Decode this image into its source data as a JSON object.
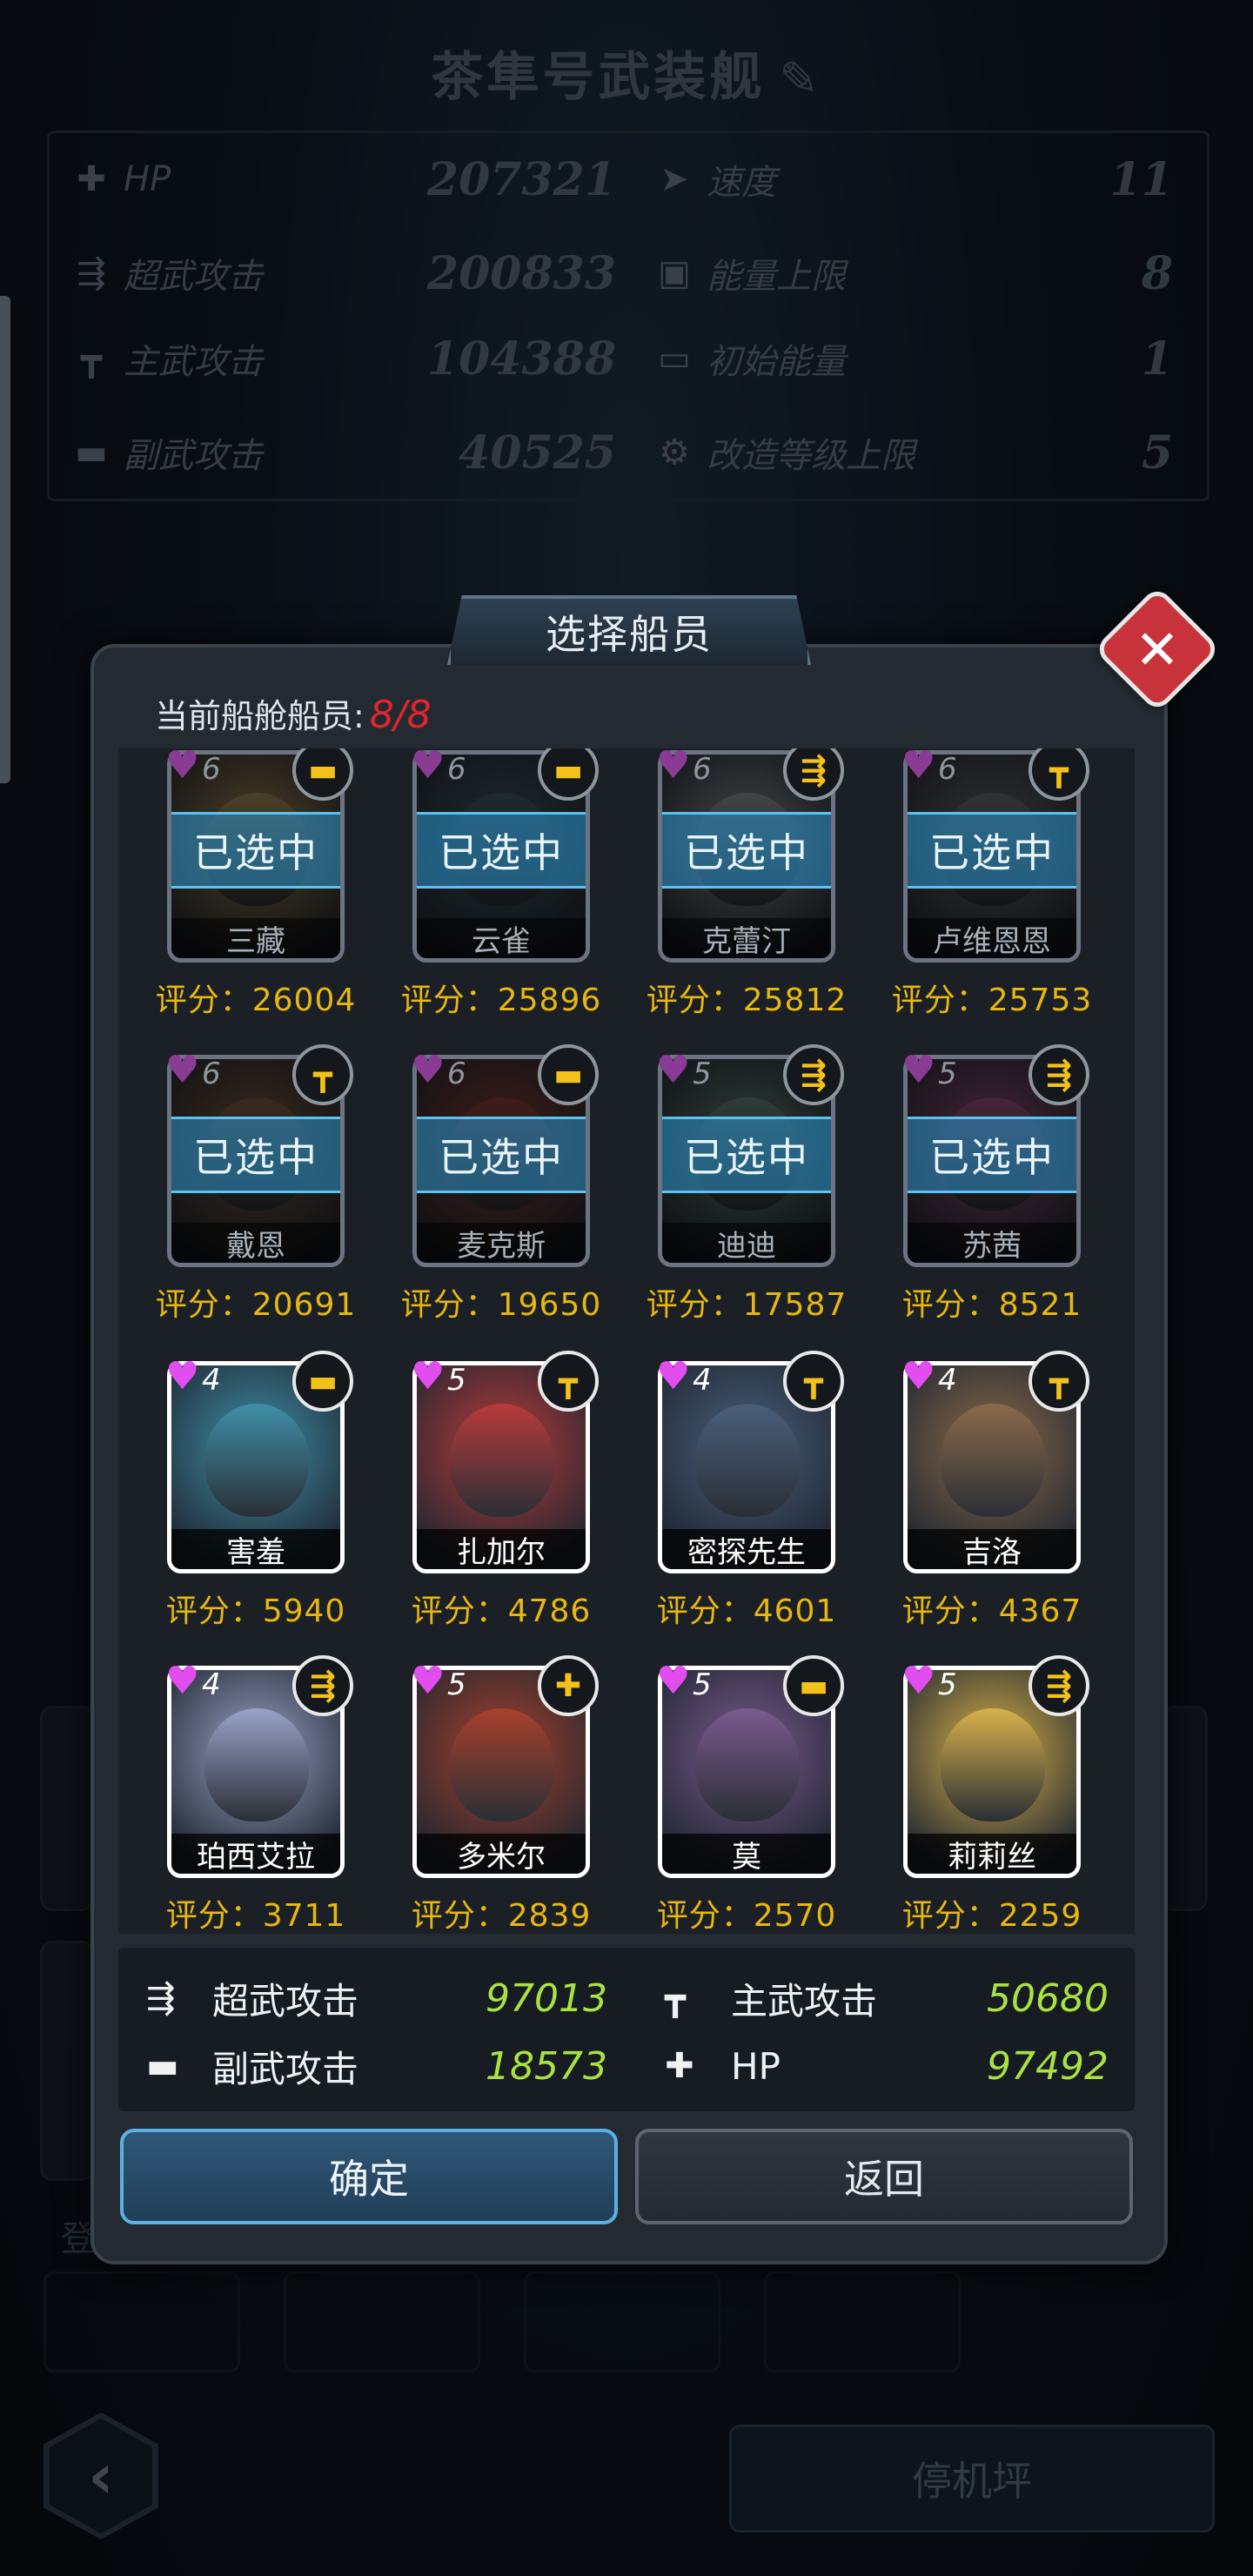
{
  "background": {
    "ship_title": "茶隼号武装舰",
    "stats_left": [
      {
        "icon": "plus-icon",
        "label": "HP",
        "value": "207321"
      },
      {
        "icon": "super-weapon-icon",
        "label": "超武攻击",
        "value": "200833"
      },
      {
        "icon": "main-weapon-icon",
        "label": "主武攻击",
        "value": "104388"
      },
      {
        "icon": "sub-weapon-icon",
        "label": "副武攻击",
        "value": "40525"
      }
    ],
    "stats_right": [
      {
        "icon": "speed-icon",
        "label": "速度",
        "value": "11"
      },
      {
        "icon": "energy-icon",
        "label": "能量上限",
        "value": "8"
      },
      {
        "icon": "battery-icon",
        "label": "初始能量",
        "value": "1"
      },
      {
        "icon": "gear-icon",
        "label": "改造等级上限",
        "value": "5"
      }
    ],
    "hangar_button": "停机坪",
    "partial_text": "登"
  },
  "modal": {
    "title": "选择船员",
    "crew_count_label": "当前船舱船员:",
    "crew_count_value": "8/8",
    "selected_label": "已选中",
    "score_prefix": "评分：",
    "crew": [
      {
        "name": "三藏",
        "level": "6",
        "weapon": "sub",
        "score": "26004",
        "selected": true,
        "color": "#b58a3e"
      },
      {
        "name": "云雀",
        "level": "6",
        "weapon": "sub",
        "score": "25896",
        "selected": true,
        "color": "#3e5e6b"
      },
      {
        "name": "克蕾汀",
        "level": "6",
        "weapon": "super",
        "score": "25812",
        "selected": true,
        "color": "#8c9aa5"
      },
      {
        "name": "卢维恩恩",
        "level": "6",
        "weapon": "main",
        "score": "25753",
        "selected": true,
        "color": "#6d6f72"
      },
      {
        "name": "戴恩",
        "level": "6",
        "weapon": "main",
        "score": "20691",
        "selected": true,
        "color": "#8a5a33"
      },
      {
        "name": "麦克斯",
        "level": "6",
        "weapon": "sub",
        "score": "19650",
        "selected": true,
        "color": "#a53a2e"
      },
      {
        "name": "迪迪",
        "level": "5",
        "weapon": "super",
        "score": "17587",
        "selected": true,
        "color": "#5a8a7e"
      },
      {
        "name": "苏茜",
        "level": "5",
        "weapon": "super",
        "score": "8521",
        "selected": true,
        "color": "#b04a86"
      },
      {
        "name": "害羞",
        "level": "4",
        "weapon": "sub",
        "score": "5940",
        "selected": false,
        "color": "#3f8fa8"
      },
      {
        "name": "扎加尔",
        "level": "5",
        "weapon": "main",
        "score": "4786",
        "selected": false,
        "color": "#b83a3a"
      },
      {
        "name": "密探先生",
        "level": "4",
        "weapon": "main",
        "score": "4601",
        "selected": false,
        "color": "#4a5e7a"
      },
      {
        "name": "吉洛",
        "level": "4",
        "weapon": "main",
        "score": "4367",
        "selected": false,
        "color": "#8a6a4a"
      },
      {
        "name": "珀西艾拉",
        "level": "4",
        "weapon": "super",
        "score": "3711",
        "selected": false,
        "color": "#9aa2c6"
      },
      {
        "name": "多米尔",
        "level": "5",
        "weapon": "hp",
        "score": "2839",
        "selected": false,
        "color": "#a8402c"
      },
      {
        "name": "莫",
        "level": "5",
        "weapon": "sub",
        "score": "2570",
        "selected": false,
        "color": "#7a5a8e"
      },
      {
        "name": "莉莉丝",
        "level": "5",
        "weapon": "super",
        "score": "2259",
        "selected": false,
        "color": "#d8b24a"
      }
    ],
    "weapon_glyphs": {
      "sub": "▬",
      "super": "⇶",
      "main": "┳",
      "hp": "✚"
    },
    "summary": [
      {
        "icon": "super-weapon-icon",
        "label": "超武攻击",
        "value": "97013"
      },
      {
        "icon": "main-weapon-icon",
        "label": "主武攻击",
        "value": "50680"
      },
      {
        "icon": "sub-weapon-icon",
        "label": "副武攻击",
        "value": "18573"
      },
      {
        "icon": "plus-icon",
        "label": "HP",
        "value": "97492"
      }
    ],
    "confirm_label": "确定",
    "back_label": "返回"
  }
}
